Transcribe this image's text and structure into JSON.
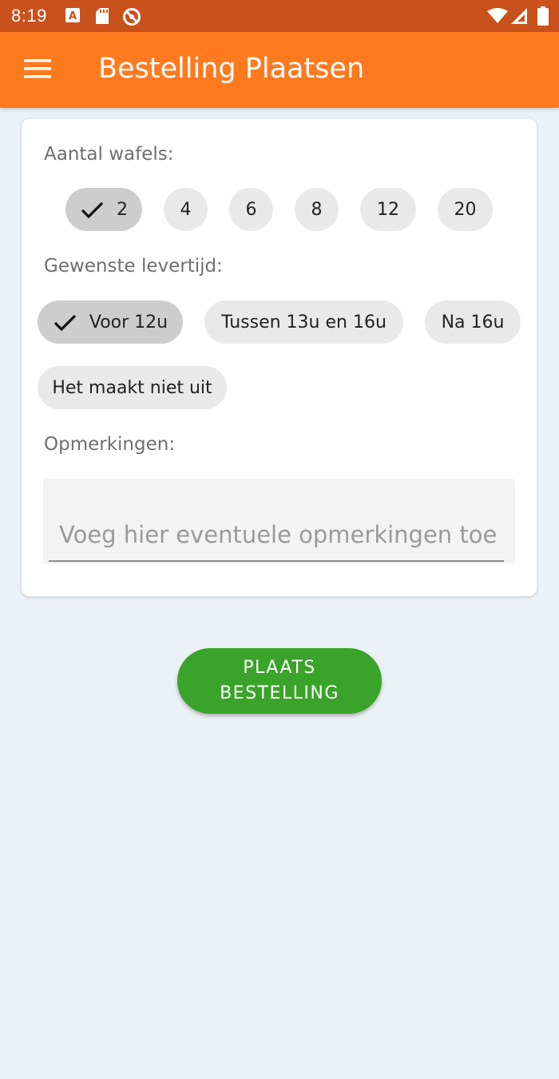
{
  "status_bar": {
    "time": "8:19",
    "icons": [
      "notification-a-icon",
      "sd-card-icon",
      "no-disturb-icon",
      "wifi-icon",
      "cell-signal-icon",
      "battery-icon"
    ]
  },
  "app_bar": {
    "title": "Bestelling Plaatsen",
    "menu_icon": "hamburger-menu-icon"
  },
  "form": {
    "waffles_label": "Aantal wafels:",
    "waffle_options": [
      "2",
      "4",
      "6",
      "8",
      "12",
      "20"
    ],
    "waffle_selected": "2",
    "delivery_label": "Gewenste levertijd:",
    "delivery_options": [
      "Voor 12u",
      "Tussen 13u en 16u",
      "Na 16u",
      "Het maakt niet uit"
    ],
    "delivery_selected": "Voor 12u",
    "remarks_label": "Opmerkingen:",
    "remarks_placeholder": "Voeg hier eventuele opmerkingen toe",
    "remarks_value": ""
  },
  "order_button": {
    "line1": "PLAATS",
    "line2": "BESTELLING"
  },
  "colors": {
    "status_bar": "#c9511b",
    "app_bar": "#ff7a1f",
    "order_button": "#3aa329",
    "background": "#ecf1f6"
  }
}
